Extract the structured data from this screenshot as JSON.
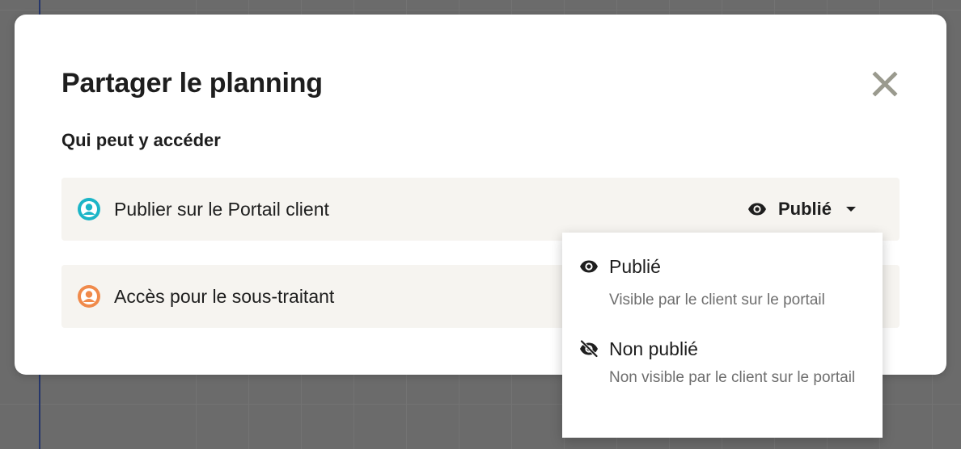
{
  "modal": {
    "title": "Partager le planning",
    "section_label": "Qui peut y accéder"
  },
  "rows": [
    {
      "label": "Publier sur le Portail client",
      "icon": "user-icon",
      "icon_color": "#1bb5c7",
      "status": "Publié"
    },
    {
      "label": "Accès pour le sous-traitant",
      "icon": "user-icon",
      "icon_color": "#f08a4b"
    }
  ],
  "dropdown": {
    "options": [
      {
        "title": "Publié",
        "description": "Visible par le client sur le portail",
        "icon": "eye-icon"
      },
      {
        "title": "Non publié",
        "description": "Non visible par le client sur le portail",
        "icon": "eye-off-icon"
      }
    ]
  },
  "colors": {
    "close_icon": "#9a9a8e",
    "row_background": "#f6f4f0",
    "backdrop": "#6b6b6b"
  }
}
